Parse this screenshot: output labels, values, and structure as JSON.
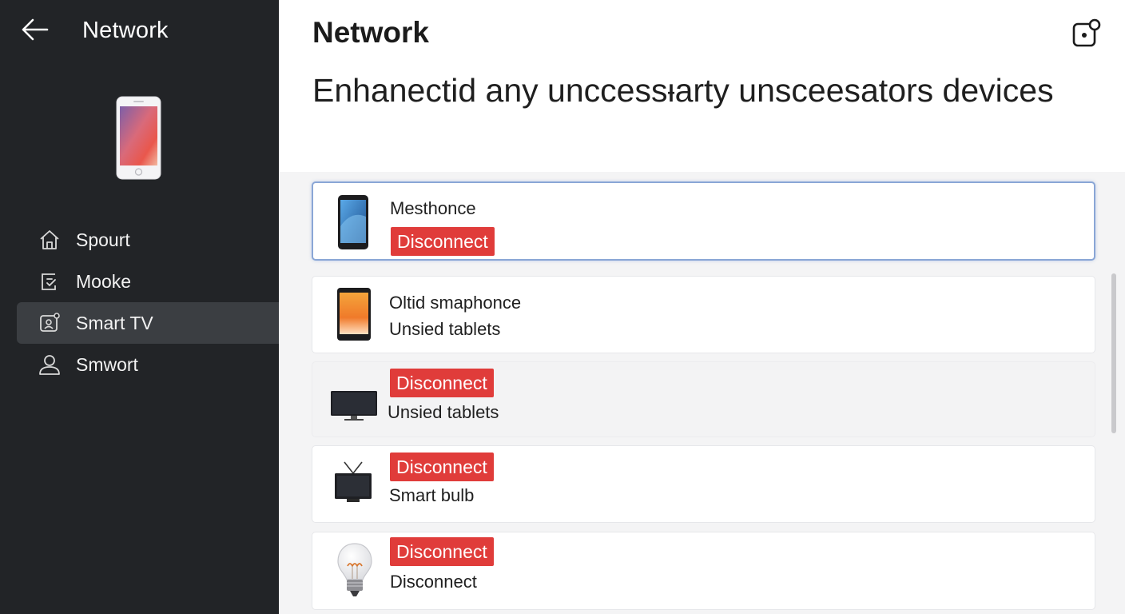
{
  "sidebar": {
    "title": "Network",
    "items": [
      {
        "label": "Spourt",
        "icon": "home-icon"
      },
      {
        "label": "Mooke",
        "icon": "device-check-icon"
      },
      {
        "label": "Smart TV",
        "icon": "screen-user-icon",
        "active": true
      },
      {
        "label": "Smwort",
        "icon": "user-icon"
      }
    ]
  },
  "main": {
    "title": "Network",
    "headline": "Enhanectid any unccessᵼarty unsceesators devices",
    "devices": [
      {
        "icon": "phone-icon",
        "name": "Mesthonce",
        "action": "Disconnect"
      },
      {
        "icon": "tablet-icon",
        "name": "Oltid smaphonce",
        "detail": "Unsied tablets"
      },
      {
        "icon": "monitor-icon",
        "action": "Disconnect",
        "detail": "Unsied tablets"
      },
      {
        "icon": "tv-icon",
        "action": "Disconnect",
        "detail": "Smart bulb"
      },
      {
        "icon": "lightbulb-icon",
        "action": "Disconnect",
        "detail": "Disconnect"
      }
    ]
  },
  "colors": {
    "sidebar_bg": "#222427",
    "sidebar_active": "#3b3e42",
    "disconnect_red": "#e03c3a",
    "selected_border": "#8aa6d6"
  }
}
